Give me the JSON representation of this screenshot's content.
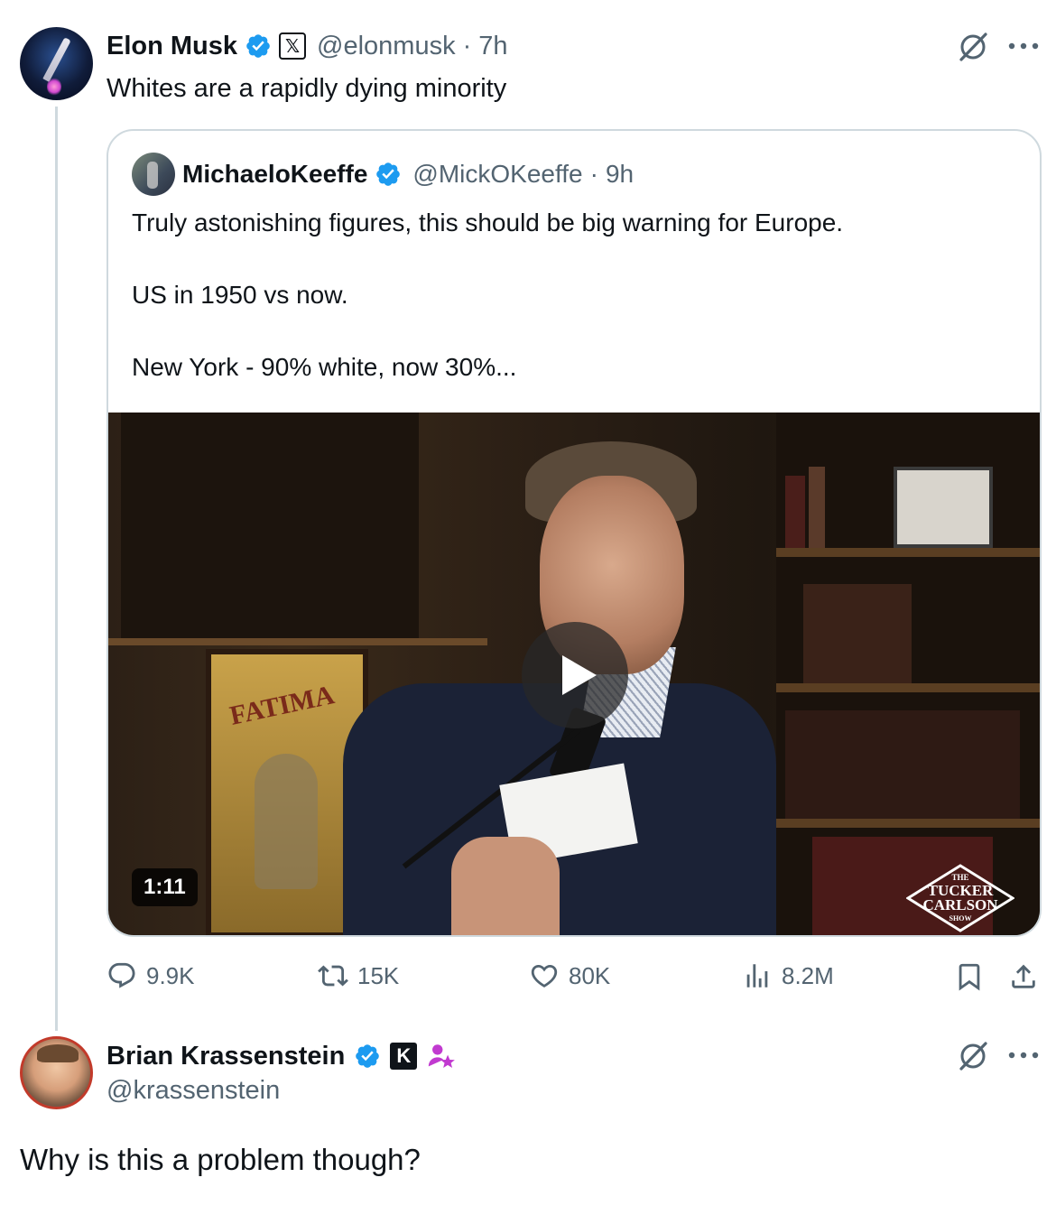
{
  "main_post": {
    "name": "Elon Musk",
    "handle": "@elonmusk",
    "separator": "·",
    "time": "7h",
    "text": "Whites are a rapidly dying minority",
    "badge_letter": "𝕏"
  },
  "quoted_post": {
    "name": "MichaeloKeeffe",
    "handle": "@MickOKeeffe",
    "separator": "·",
    "time": "9h",
    "line1": "Truly astonishing figures, this should be big warning for Europe.",
    "line2": "US in 1950 vs now.",
    "line3": "New York - 90% white, now 30%...",
    "video": {
      "duration": "1:11",
      "poster_text": "FATIMA",
      "logo_top": "THE",
      "logo_line1": "TUCKER",
      "logo_line2": "CARLSON",
      "logo_bottom": "SHOW"
    }
  },
  "actions": {
    "replies": "9.9K",
    "reposts": "15K",
    "likes": "80K",
    "views": "8.2M"
  },
  "reply_post": {
    "name": "Brian Krassenstein",
    "handle": "@krassenstein",
    "badge_letter": "K",
    "text": "Why is this a problem though?"
  },
  "colors": {
    "verified": "#1d9bf0",
    "muted": "#536471",
    "border": "#cfd9de",
    "text": "#0f1419"
  }
}
